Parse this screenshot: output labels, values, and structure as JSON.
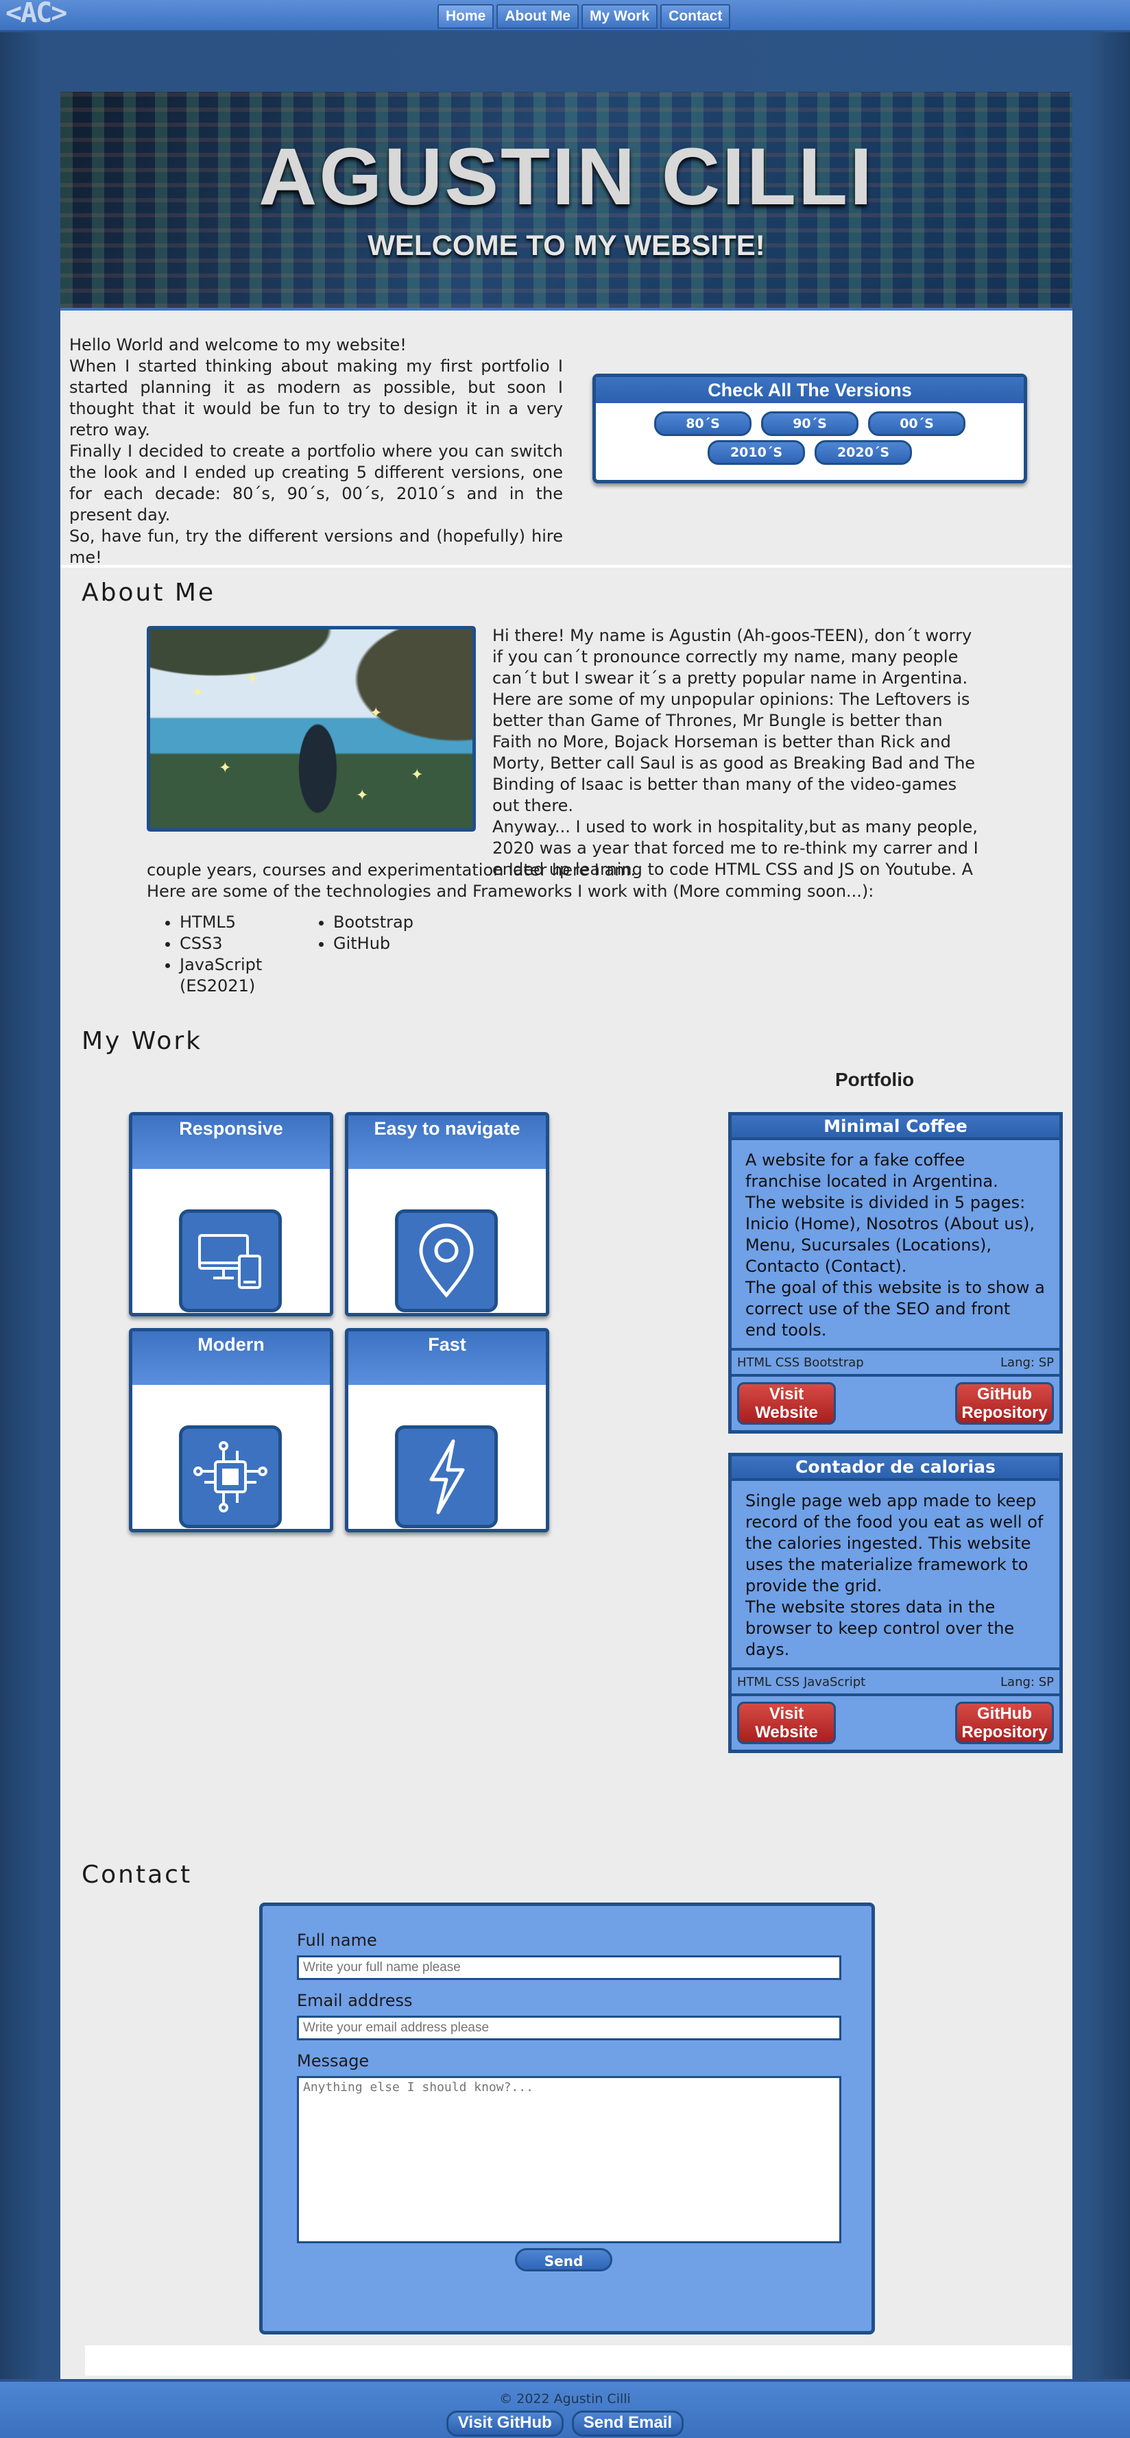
{
  "header": {
    "logo": "<AC>",
    "nav": [
      {
        "label": "Home"
      },
      {
        "label": "About Me"
      },
      {
        "label": "My Work"
      },
      {
        "label": "Contact"
      }
    ]
  },
  "hero": {
    "title": "AGUSTIN CILLI",
    "subtitle": "WELCOME TO MY WEBSITE!"
  },
  "intro": {
    "lines": [
      "Hello World and welcome to my website!",
      "When I started thinking about making my first portfolio I started planning it as modern as possible, but soon I thought that it would be fun to try to design it in a very retro way.",
      "Finally I decided to create a portfolio where you can switch the look and I ended up creating 5 different versions, one for each decade: 80´s, 90´s, 00´s, 2010´s and in the present day.",
      "So, have fun, try the different versions and (hopefully) hire me!"
    ]
  },
  "versions": {
    "title": "Check All The Versions",
    "items": [
      "80´S",
      "90´S",
      "00´S",
      "2010´S",
      "2020´S"
    ]
  },
  "about": {
    "title": "About Me",
    "paragraphs": [
      "Hi there! My name is Agustin (Ah-goos-TEEN), don´t worry if you can´t pronounce correctly my name, many people can´t but I swear it´s a pretty popular name in Argentina.",
      "Here are some of my unpopular opinions: The Leftovers is better than Game of Thrones, Mr Bungle is better than Faith no More, Bojack Horseman is better than Rick and Morty, Better call Saul is as good as Breaking Bad and The Binding of Isaac is better than many of the video-games out there.",
      "Anyway... I used to work in hospitality,but as many people, 2020 was a year that forced me to re-think my carrer and I ended up learning to code HTML CSS and JS on Youtube. A"
    ],
    "continued": "couple years, courses and experimentation later here I am.",
    "tech_intro": "Here are some of the technologies and Frameworks I work with (More comming soon...):",
    "tech_col1": [
      "HTML5",
      "CSS3",
      "JavaScript (ES2021)"
    ],
    "tech_col2": [
      "Bootstrap",
      "GitHub"
    ]
  },
  "work": {
    "title": "My Work",
    "features": [
      {
        "title": "Responsive",
        "icon": "devices-icon"
      },
      {
        "title": "Easy to navigate",
        "icon": "location-pin-icon"
      },
      {
        "title": "Modern",
        "icon": "chip-icon"
      },
      {
        "title": "Fast",
        "icon": "lightning-icon"
      }
    ],
    "portfolio_title": "Portfolio",
    "projects": [
      {
        "title": "Minimal Coffee",
        "description": [
          "A website for a fake coffee franchise located in Argentina.",
          "The website is divided in 5 pages: Inicio (Home), Nosotros (About us), Menu, Sucursales (Locations), Contacto (Contact).",
          "The goal of this website is to show a correct use of the SEO and front end tools."
        ],
        "tech": "HTML CSS Bootstrap",
        "lang": "Lang: SP",
        "visit": "Visit Website",
        "repo": "GitHub Repository"
      },
      {
        "title": "Contador de calorias",
        "description": [
          "Single page web app made to keep record of the food you eat as well of the calories ingested. This website uses the materialize framework to provide the grid.",
          "The website stores data in the browser to keep control over the days."
        ],
        "tech": "HTML CSS JavaScript",
        "lang": "Lang: SP",
        "visit": "Visit Website",
        "repo": "GitHub Repository"
      }
    ]
  },
  "contact": {
    "title": "Contact",
    "name_label": "Full name",
    "name_placeholder": "Write your full name please",
    "email_label": "Email address",
    "email_placeholder": "Write your email address please",
    "message_label": "Message",
    "message_placeholder": "Anything else I should know?...",
    "send": "Send"
  },
  "footer": {
    "copyright": "© 2022 Agustin Cilli",
    "github": "Visit GitHub",
    "email": "Send Email"
  }
}
